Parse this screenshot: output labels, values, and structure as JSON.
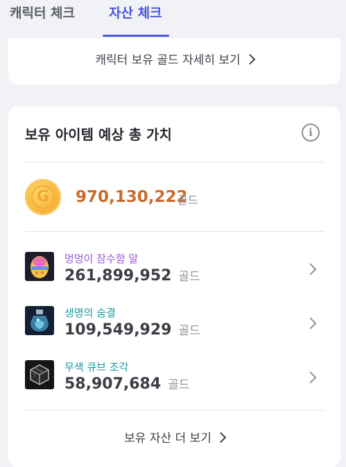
{
  "tabs": [
    {
      "label": "캐릭터 체크",
      "active": false
    },
    {
      "label": "자산 체크",
      "active": true
    }
  ],
  "character_gold_link": "캐릭터 보유 골드 자세히 보기",
  "asset_card": {
    "title": "보유 아이템 예상 총 가치",
    "info_icon": "info-icon",
    "gold": {
      "amount": "970,130,222",
      "unit": "골드"
    },
    "items": [
      {
        "name": "멍멍이 잠수함 알",
        "name_color": "#9a55d8",
        "value": "261,899,952",
        "unit": "골드",
        "icon": "egg-icon"
      },
      {
        "name": "생명의 숨결",
        "name_color": "#1a9aa0",
        "value": "109,549,929",
        "unit": "골드",
        "icon": "potion-icon"
      },
      {
        "name": "무색 큐브 조각",
        "name_color": "#1a9aa0",
        "value": "58,907,684",
        "unit": "골드",
        "icon": "cube-icon"
      }
    ],
    "more_link": "보유 자산 더 보기"
  },
  "colors": {
    "accent": "#4a54e0",
    "gold_amount": "#cc6a2c"
  }
}
